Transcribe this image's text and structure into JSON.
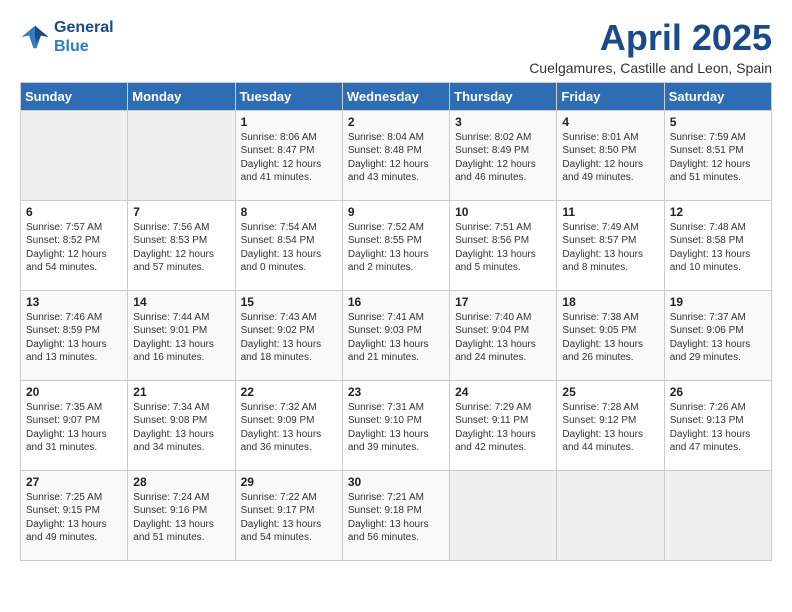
{
  "header": {
    "logo_line1": "General",
    "logo_line2": "Blue",
    "title": "April 2025",
    "subtitle": "Cuelgamures, Castille and Leon, Spain"
  },
  "days_of_week": [
    "Sunday",
    "Monday",
    "Tuesday",
    "Wednesday",
    "Thursday",
    "Friday",
    "Saturday"
  ],
  "weeks": [
    [
      {
        "num": "",
        "info": ""
      },
      {
        "num": "",
        "info": ""
      },
      {
        "num": "1",
        "info": "Sunrise: 8:06 AM\nSunset: 8:47 PM\nDaylight: 12 hours and 41 minutes."
      },
      {
        "num": "2",
        "info": "Sunrise: 8:04 AM\nSunset: 8:48 PM\nDaylight: 12 hours and 43 minutes."
      },
      {
        "num": "3",
        "info": "Sunrise: 8:02 AM\nSunset: 8:49 PM\nDaylight: 12 hours and 46 minutes."
      },
      {
        "num": "4",
        "info": "Sunrise: 8:01 AM\nSunset: 8:50 PM\nDaylight: 12 hours and 49 minutes."
      },
      {
        "num": "5",
        "info": "Sunrise: 7:59 AM\nSunset: 8:51 PM\nDaylight: 12 hours and 51 minutes."
      }
    ],
    [
      {
        "num": "6",
        "info": "Sunrise: 7:57 AM\nSunset: 8:52 PM\nDaylight: 12 hours and 54 minutes."
      },
      {
        "num": "7",
        "info": "Sunrise: 7:56 AM\nSunset: 8:53 PM\nDaylight: 12 hours and 57 minutes."
      },
      {
        "num": "8",
        "info": "Sunrise: 7:54 AM\nSunset: 8:54 PM\nDaylight: 13 hours and 0 minutes."
      },
      {
        "num": "9",
        "info": "Sunrise: 7:52 AM\nSunset: 8:55 PM\nDaylight: 13 hours and 2 minutes."
      },
      {
        "num": "10",
        "info": "Sunrise: 7:51 AM\nSunset: 8:56 PM\nDaylight: 13 hours and 5 minutes."
      },
      {
        "num": "11",
        "info": "Sunrise: 7:49 AM\nSunset: 8:57 PM\nDaylight: 13 hours and 8 minutes."
      },
      {
        "num": "12",
        "info": "Sunrise: 7:48 AM\nSunset: 8:58 PM\nDaylight: 13 hours and 10 minutes."
      }
    ],
    [
      {
        "num": "13",
        "info": "Sunrise: 7:46 AM\nSunset: 8:59 PM\nDaylight: 13 hours and 13 minutes."
      },
      {
        "num": "14",
        "info": "Sunrise: 7:44 AM\nSunset: 9:01 PM\nDaylight: 13 hours and 16 minutes."
      },
      {
        "num": "15",
        "info": "Sunrise: 7:43 AM\nSunset: 9:02 PM\nDaylight: 13 hours and 18 minutes."
      },
      {
        "num": "16",
        "info": "Sunrise: 7:41 AM\nSunset: 9:03 PM\nDaylight: 13 hours and 21 minutes."
      },
      {
        "num": "17",
        "info": "Sunrise: 7:40 AM\nSunset: 9:04 PM\nDaylight: 13 hours and 24 minutes."
      },
      {
        "num": "18",
        "info": "Sunrise: 7:38 AM\nSunset: 9:05 PM\nDaylight: 13 hours and 26 minutes."
      },
      {
        "num": "19",
        "info": "Sunrise: 7:37 AM\nSunset: 9:06 PM\nDaylight: 13 hours and 29 minutes."
      }
    ],
    [
      {
        "num": "20",
        "info": "Sunrise: 7:35 AM\nSunset: 9:07 PM\nDaylight: 13 hours and 31 minutes."
      },
      {
        "num": "21",
        "info": "Sunrise: 7:34 AM\nSunset: 9:08 PM\nDaylight: 13 hours and 34 minutes."
      },
      {
        "num": "22",
        "info": "Sunrise: 7:32 AM\nSunset: 9:09 PM\nDaylight: 13 hours and 36 minutes."
      },
      {
        "num": "23",
        "info": "Sunrise: 7:31 AM\nSunset: 9:10 PM\nDaylight: 13 hours and 39 minutes."
      },
      {
        "num": "24",
        "info": "Sunrise: 7:29 AM\nSunset: 9:11 PM\nDaylight: 13 hours and 42 minutes."
      },
      {
        "num": "25",
        "info": "Sunrise: 7:28 AM\nSunset: 9:12 PM\nDaylight: 13 hours and 44 minutes."
      },
      {
        "num": "26",
        "info": "Sunrise: 7:26 AM\nSunset: 9:13 PM\nDaylight: 13 hours and 47 minutes."
      }
    ],
    [
      {
        "num": "27",
        "info": "Sunrise: 7:25 AM\nSunset: 9:15 PM\nDaylight: 13 hours and 49 minutes."
      },
      {
        "num": "28",
        "info": "Sunrise: 7:24 AM\nSunset: 9:16 PM\nDaylight: 13 hours and 51 minutes."
      },
      {
        "num": "29",
        "info": "Sunrise: 7:22 AM\nSunset: 9:17 PM\nDaylight: 13 hours and 54 minutes."
      },
      {
        "num": "30",
        "info": "Sunrise: 7:21 AM\nSunset: 9:18 PM\nDaylight: 13 hours and 56 minutes."
      },
      {
        "num": "",
        "info": ""
      },
      {
        "num": "",
        "info": ""
      },
      {
        "num": "",
        "info": ""
      }
    ]
  ]
}
